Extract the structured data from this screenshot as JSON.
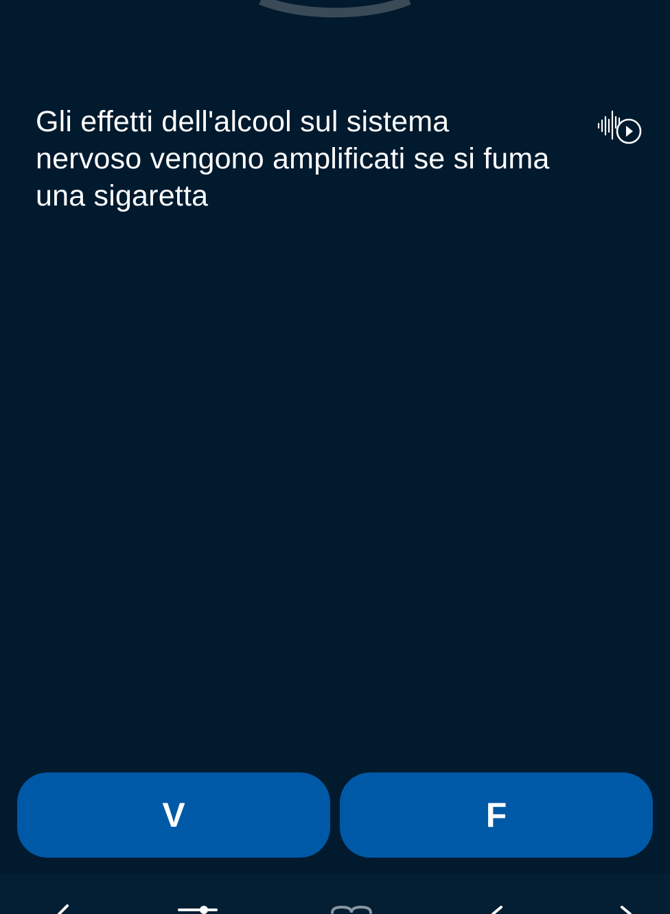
{
  "question": {
    "lines": [
      "Gli effetti dell'alcool sul sistema",
      "nervoso vengono amplificati se si fuma",
      "una sigaretta"
    ]
  },
  "audio": {
    "icon": "audio-play-icon"
  },
  "answers": {
    "true_label": "V",
    "false_label": "F"
  },
  "bottom_nav": {
    "icons": [
      "back-arrow-icon",
      "settings-slider-icon",
      "book-icon",
      "previous-icon",
      "next-icon"
    ]
  },
  "colors": {
    "background": "#021a2e",
    "button": "#0059a6",
    "text": "#ffffff",
    "ring": "#3a4a57"
  }
}
